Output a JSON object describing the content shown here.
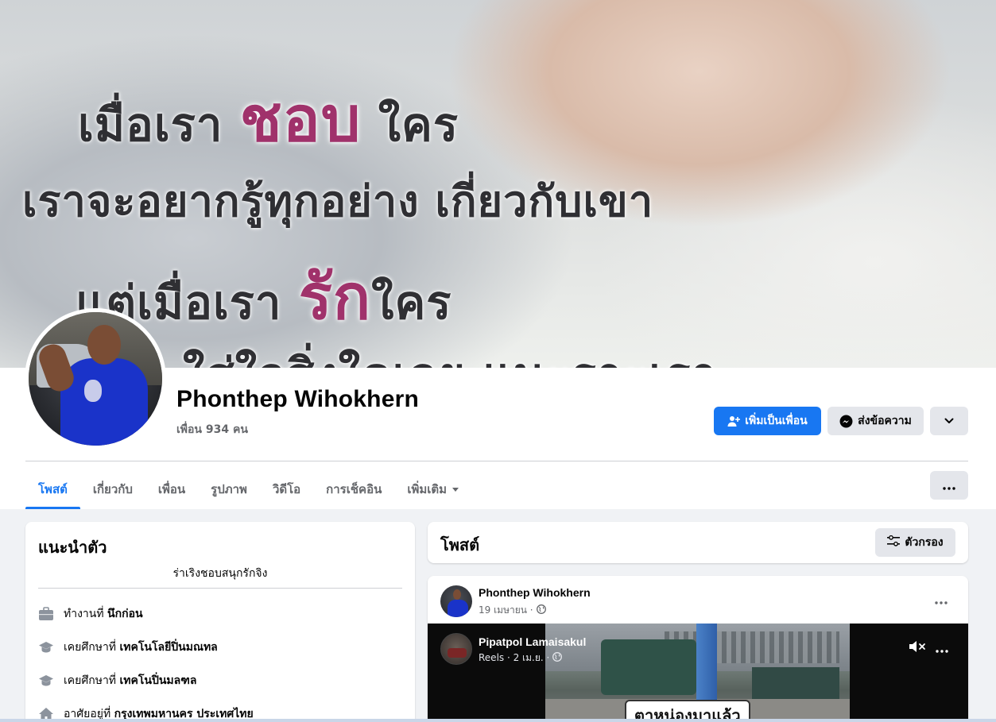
{
  "cover": {
    "line1_a": "เมื่อเรา ",
    "line1_hl": "ชอบ",
    "line1_b": " ใคร",
    "line2": "เราจะอยากรู้ทุกอย่าง เกี่ยวกับเขา",
    "line3_a": "แต่เมื่อเรา ",
    "line3_hl": "รัก",
    "line3_b": "ใคร",
    "line4": "ใส่ใจสิ่งใดเลย แนะราะเรา"
  },
  "profile": {
    "name": "Phonthep Wihokhern",
    "friends": "เพื่อน 934 คน"
  },
  "actions": {
    "add_friend": "เพิ่มเป็นเพื่อน",
    "message": "ส่งข้อความ"
  },
  "tabs": [
    {
      "label": "โพสต์"
    },
    {
      "label": "เกี่ยวกับ"
    },
    {
      "label": "เพื่อน"
    },
    {
      "label": "รูปภาพ"
    },
    {
      "label": "วิดีโอ"
    },
    {
      "label": "การเช็คอิน"
    },
    {
      "label": "เพิ่มเติม"
    }
  ],
  "intro": {
    "title": "แนะนำตัว",
    "bio": "ร่าเริงชอบสนุกรักจิง",
    "items": [
      {
        "prefix": "ทำงานที่ ",
        "value": "นึกก่อน"
      },
      {
        "prefix": "เคยศึกษาที่ ",
        "value": "เทคโนโลยีปิ่นมณทล"
      },
      {
        "prefix": "เคยศึกษาที่ ",
        "value": "เทคโนปิ่นมลฑล"
      },
      {
        "prefix": "อาศัยอยู่ที่ ",
        "value": "กรุงเทพมหานคร ประเทศไทย"
      }
    ]
  },
  "posts": {
    "title": "โพสต์",
    "filter_label": "ตัวกรอง"
  },
  "post": {
    "author": "Phonthep Wihokhern",
    "date": "19 เมษายน ·",
    "shared": {
      "author": "Pipatpol Lamaisakul",
      "meta": "Reels · 2 เม.ย. ·",
      "video_caption": "ตาหน่องมาแล้ว"
    }
  },
  "colors": {
    "accent": "#1877f2",
    "highlight": "#a0326b",
    "background": "#f0f2f5"
  }
}
